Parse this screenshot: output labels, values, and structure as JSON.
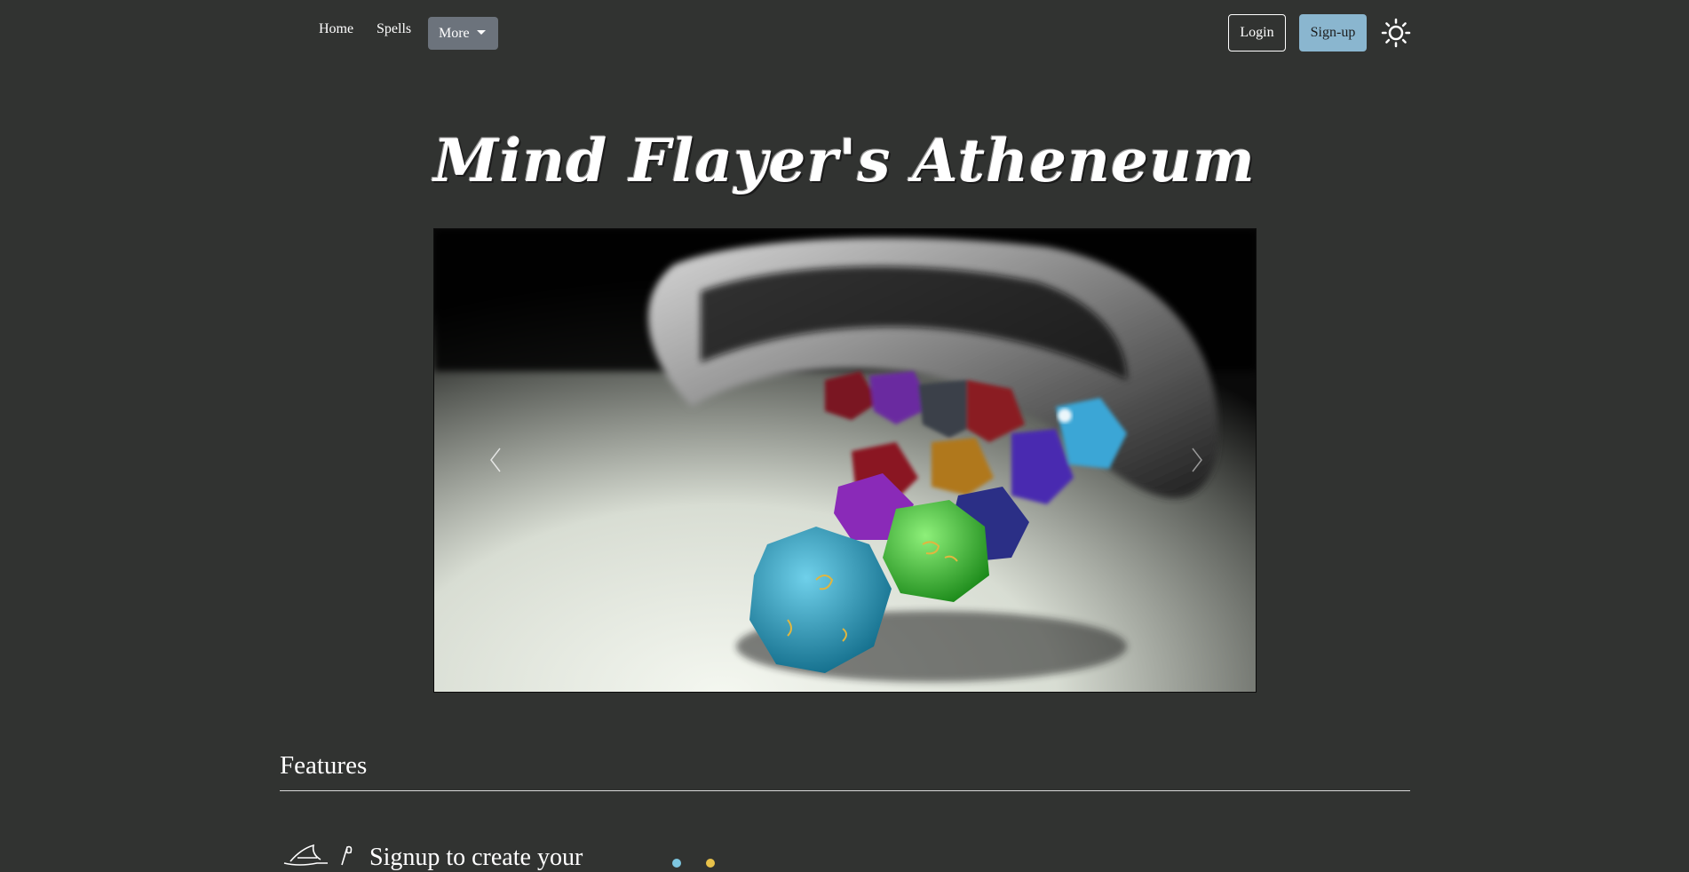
{
  "nav": {
    "home": "Home",
    "spells": "Spells",
    "more": "More",
    "login": "Login",
    "signup": "Sign-up",
    "theme_icon": "sun-icon"
  },
  "hero": {
    "title": "Mind Flayer's Atheneum",
    "carousel_prev_icon": "chevron-left-icon",
    "carousel_next_icon": "chevron-right-icon"
  },
  "features": {
    "heading": "Features",
    "items": [
      {
        "text": "Signup to create your",
        "icon": "wizard-hat-icon"
      }
    ]
  },
  "colors": {
    "background": "#313331",
    "more_button": "#6c737c",
    "signup_button": "#8ab6cf"
  }
}
